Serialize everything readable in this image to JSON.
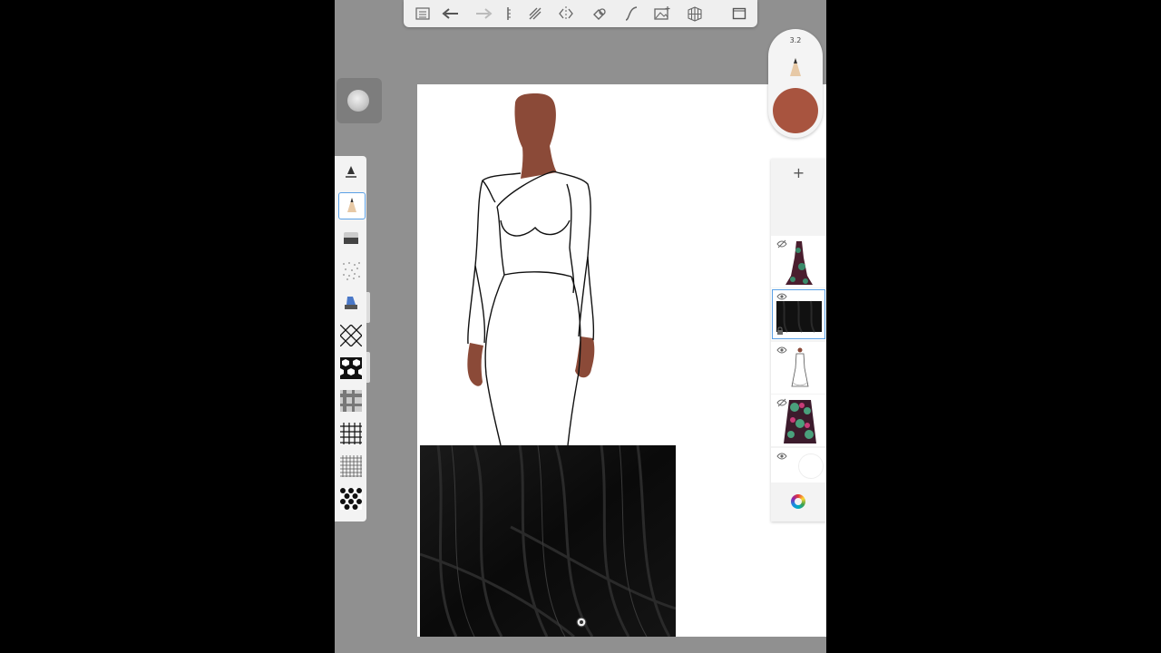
{
  "app": {
    "toolbar": {
      "icons": [
        "list-icon",
        "undo-icon",
        "redo-icon",
        "ruler-icon",
        "transform-icon",
        "symmetry-icon",
        "fill-icon",
        "curve-icon",
        "add-image-icon",
        "perspective-icon",
        "fullscreen-icon"
      ]
    },
    "tools": {
      "icons": [
        "pen-icon",
        "pencil-icon",
        "eraser-icon",
        "dots-pattern-icon",
        "marker-icon",
        "diamond-grid-icon",
        "hexagon-pattern-icon",
        "plaid-icon",
        "grid-icon",
        "fine-grid-icon",
        "polka-dot-icon"
      ],
      "selected": "pencil-icon"
    },
    "brush": {
      "size_label": "3.2",
      "color": "#a8543f"
    },
    "layers": {
      "add_label": "+",
      "items": [
        {
          "name": "floral-dress",
          "visible": false
        },
        {
          "name": "black-fabric",
          "visible": true,
          "selected": true
        },
        {
          "name": "croquis-sketch",
          "visible": true
        },
        {
          "name": "floral-fabric",
          "visible": false
        },
        {
          "name": "background",
          "visible": true
        }
      ]
    },
    "colors": {
      "skin": "#8b4a38",
      "fabric": "#0d0d0d",
      "accent": "#5aa0e6"
    }
  }
}
